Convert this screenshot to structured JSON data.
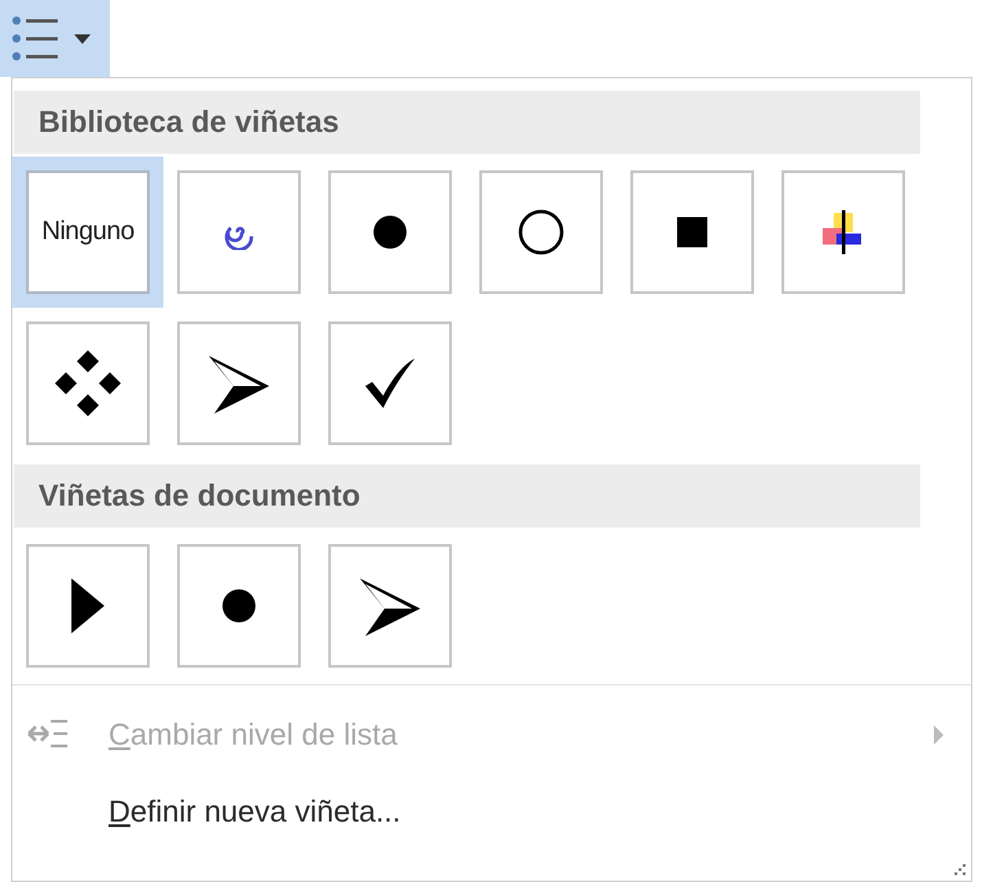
{
  "toolbar_button": {
    "pressed": true
  },
  "sections": [
    {
      "title": "Biblioteca de viñetas",
      "bullets": [
        {
          "kind": "none",
          "label": "Ninguno",
          "selected": true
        },
        {
          "kind": "spiral",
          "selected": false
        },
        {
          "kind": "disc",
          "selected": false
        },
        {
          "kind": "circle",
          "selected": false
        },
        {
          "kind": "square",
          "selected": false
        },
        {
          "kind": "cross",
          "selected": false
        },
        {
          "kind": "diamonds",
          "selected": false
        },
        {
          "kind": "arrowhead",
          "selected": false
        },
        {
          "kind": "check",
          "selected": false
        }
      ]
    },
    {
      "title": "Viñetas de documento",
      "bullets": [
        {
          "kind": "triangle",
          "selected": false
        },
        {
          "kind": "disc",
          "selected": false
        },
        {
          "kind": "arrowhead",
          "selected": false
        }
      ]
    }
  ],
  "menu_items": [
    {
      "kind": "level",
      "label": "Cambiar nivel de lista",
      "disabled": true,
      "submenu": true
    },
    {
      "kind": "define",
      "label": "Definir nueva viñeta...",
      "disabled": false,
      "submenu": false
    }
  ]
}
